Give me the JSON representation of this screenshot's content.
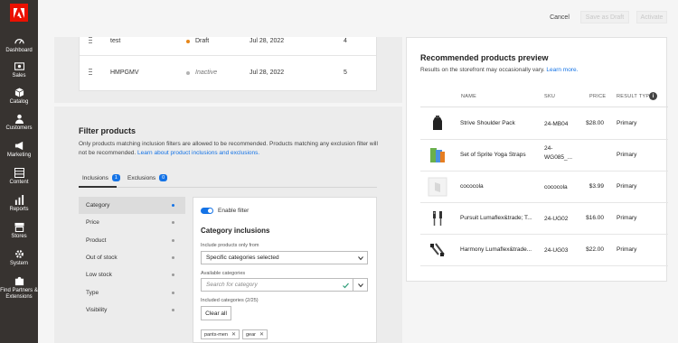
{
  "sidebar": {
    "items": [
      {
        "label": "Dashboard",
        "icon": "dashboard-icon"
      },
      {
        "label": "Sales",
        "icon": "dollar-icon"
      },
      {
        "label": "Catalog",
        "icon": "cube-icon"
      },
      {
        "label": "Customers",
        "icon": "people-icon"
      },
      {
        "label": "Marketing",
        "icon": "megaphone-icon"
      },
      {
        "label": "Content",
        "icon": "layout-icon"
      },
      {
        "label": "Reports",
        "icon": "bar-chart-icon"
      },
      {
        "label": "Stores",
        "icon": "store-icon"
      },
      {
        "label": "System",
        "icon": "gear-icon"
      },
      {
        "label": "Find Partners & Extensions",
        "icon": "puzzle-icon"
      }
    ]
  },
  "actions": {
    "cancel": "Cancel",
    "save_draft": "Save as Draft",
    "activate": "Activate"
  },
  "rules_table": {
    "rows": [
      {
        "name": "test",
        "status": "Draft",
        "status_color": "#e68619",
        "date": "Jul 28, 2022",
        "position": "4"
      },
      {
        "name": "HMPGMV",
        "status": "Inactive",
        "status_color": "#b3b3b3",
        "date": "Jul 28, 2022",
        "position": "5"
      }
    ]
  },
  "filter": {
    "title": "Filter products",
    "description": "Only products matching inclusion filters are allowed to be recommended. Products matching any exclusion filter will not be recommended.",
    "link": "Learn about product inclusions and exclusions.",
    "tabs": [
      {
        "label": "Inclusions",
        "count": "1"
      },
      {
        "label": "Exclusions",
        "count": "0"
      }
    ],
    "categories": [
      "Category",
      "Price",
      "Product",
      "Out of stock",
      "Low stock",
      "Type",
      "Visibility"
    ],
    "enable_label": "Enable filter",
    "inclusion_title": "Category inclusions",
    "include_label": "Include products only from",
    "include_value": "Specific categories selected",
    "available_label": "Available categories",
    "search_placeholder": "Search for category",
    "included_label": "Included categories (2/25)",
    "clear_label": "Clear all",
    "tags": [
      "pants-men",
      "gear"
    ]
  },
  "preview": {
    "title": "Recommended products preview",
    "subtitle": "Results on the storefront may occasionally vary.",
    "learn_more": "Learn more.",
    "headers": {
      "name": "NAME",
      "sku": "SKU",
      "price": "PRICE",
      "result_type": "RESULT TYPE"
    },
    "rows": [
      {
        "name": "Strive Shoulder Pack",
        "sku": "24-MB04",
        "price": "$28.00",
        "type": "Primary"
      },
      {
        "name": "Set of Sprite Yoga Straps",
        "sku": "24-WG085_...",
        "price": "",
        "type": "Primary"
      },
      {
        "name": "cococola",
        "sku": "cococola",
        "price": "$3.99",
        "type": "Primary"
      },
      {
        "name": "Pursuit Lumaflex&trade; T...",
        "sku": "24-UG02",
        "price": "$16.00",
        "type": "Primary"
      },
      {
        "name": "Harmony Lumaflex&trade...",
        "sku": "24-UG03",
        "price": "$22.00",
        "type": "Primary"
      }
    ]
  }
}
